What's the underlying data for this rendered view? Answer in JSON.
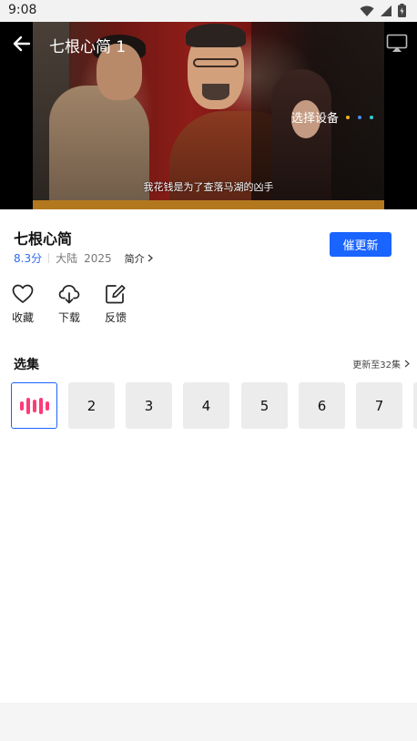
{
  "status_bar": {
    "time": "9:08"
  },
  "player": {
    "title": "七根心简 1",
    "select_device_label": "选择设备",
    "dot_colors": [
      "#f2b01e",
      "#4a8ef5",
      "#2fd0d6"
    ],
    "subtitle": "我花钱是为了查落马湖的凶手"
  },
  "show": {
    "title": "七根心简",
    "rating": "8.3分",
    "region": "大陆",
    "year": "2025",
    "intro_label": "简介",
    "update_button_label": "催更新"
  },
  "actions": [
    {
      "label": "收藏",
      "icon": "heart-icon"
    },
    {
      "label": "下载",
      "icon": "cloud-download-icon"
    },
    {
      "label": "反馈",
      "icon": "edit-icon"
    }
  ],
  "episodes": {
    "title": "选集",
    "updated_label": "更新至32集",
    "items": [
      "1",
      "2",
      "3",
      "4",
      "5",
      "6",
      "7"
    ],
    "current": "1"
  },
  "colors": {
    "accent": "#1a64ff",
    "playing_bars": "#ff3a78",
    "rating": "#2f6be8"
  }
}
